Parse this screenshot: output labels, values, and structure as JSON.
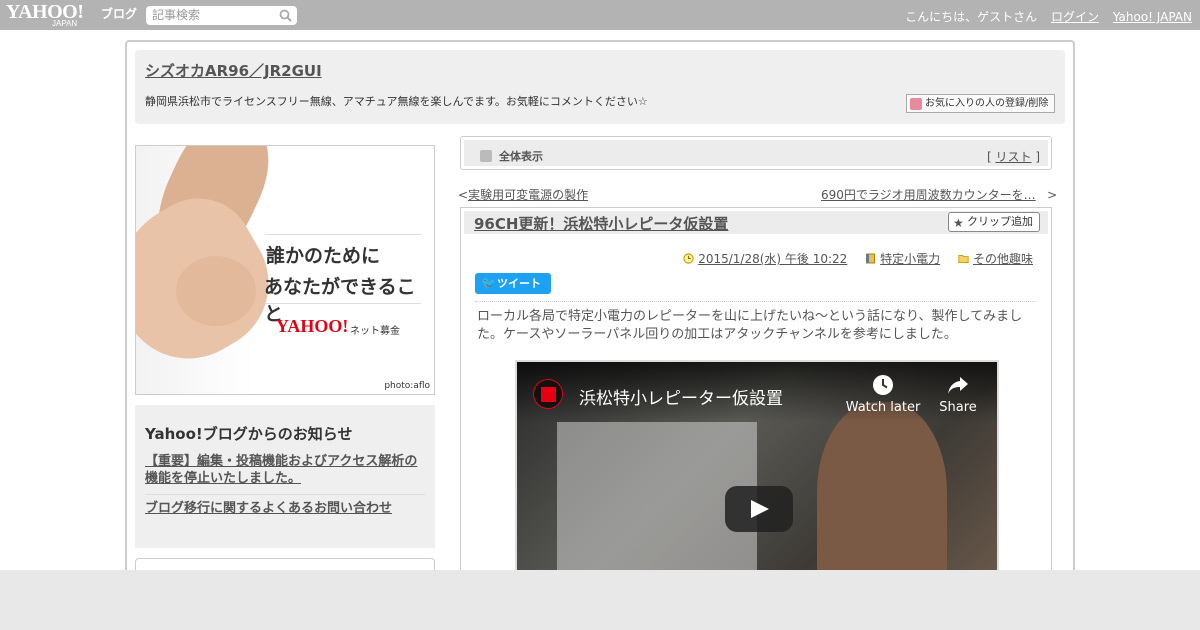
{
  "topbar": {
    "logo": "YAHOO!",
    "logo_sub": "JAPAN",
    "logo_blog": "ブログ",
    "search_placeholder": "記事検索",
    "greeting": "こんにちは、ゲストさん",
    "login": "ログイン",
    "yahoo_japan": "Yahoo! JAPAN"
  },
  "header": {
    "title": "シズオカAR96／JR2GUI",
    "description": "静岡県浜松市でライセンスフリー無線、アマチュア無線を楽しんでます。お気軽にコメントください☆",
    "favorite_button": "お気に入りの人の登録/削除"
  },
  "ad": {
    "line1": "誰かのために",
    "line2": "あなたができること",
    "logo": "YAHOO!",
    "logo_sub": "ネット募金",
    "credit": "photo:aflo"
  },
  "notice": {
    "title": "Yahoo!ブログからのお知らせ",
    "items": [
      "【重要】編集・投稿機能およびアクセス解析の機能を停止いたしました。",
      "ブログ移行に関するよくあるお問い合わせ"
    ]
  },
  "view_bar": {
    "label": "全体表示",
    "list_open": "[",
    "list": "リスト",
    "list_close": "]"
  },
  "nav": {
    "prev_mark": "<",
    "prev": "実験用可変電源の製作",
    "next": "690円でラジオ用周波数カウンターを…",
    "next_mark": ">"
  },
  "article": {
    "title": "96CH更新！浜松特小レピータ仮設置",
    "clip_button": "クリップ追加",
    "date": "2015/1/28(水) 午後 10:22",
    "category1": "特定小電力",
    "category2": "その他趣味",
    "tweet": "ツイート",
    "body": "ローカル各局で特定小電力のレピーターを山に上げたいね～という話になり、製作してみました。ケースやソーラーパネル回りの加工はアタックチャンネルを参考にしました。"
  },
  "video": {
    "title": "浜松特小レピーター仮設置",
    "watch_later": "Watch later",
    "share": "Share"
  }
}
